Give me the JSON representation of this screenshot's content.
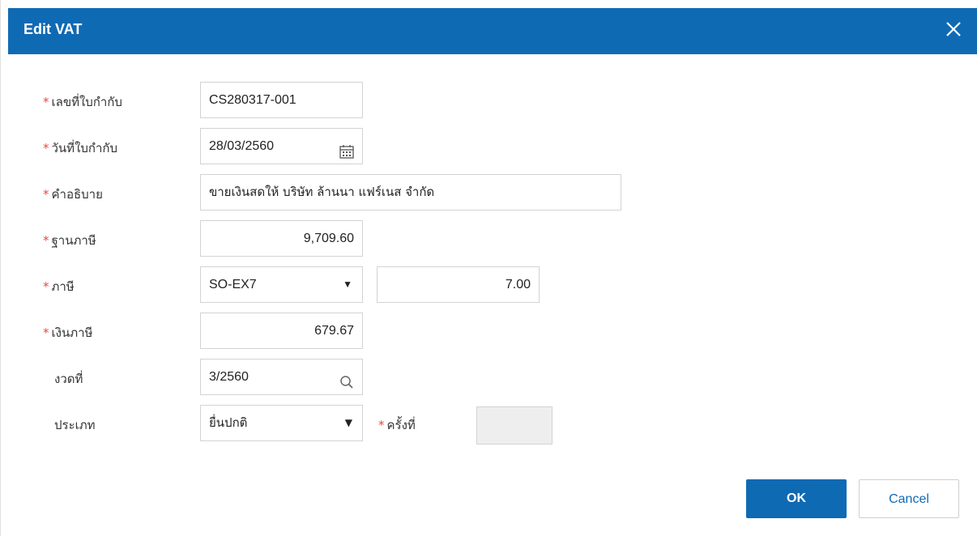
{
  "dialog": {
    "title": "Edit VAT",
    "close_icon": "close-icon"
  },
  "form": {
    "doc_no": {
      "label": "เลขที่ใบกำกับ",
      "required": true,
      "value": "CS280317-001"
    },
    "doc_date": {
      "label": "วันที่ใบกำกับ",
      "required": true,
      "value": "28/03/2560",
      "icon": "calendar-icon"
    },
    "description": {
      "label": "คำอธิบาย",
      "required": true,
      "value": "ขายเงินสดให้ บริษัท ล้านนา แฟร์เนส จำกัด"
    },
    "tax_base": {
      "label": "ฐานภาษี",
      "required": true,
      "value": "9,709.60"
    },
    "tax": {
      "label": "ภาษี",
      "required": true,
      "selected": "SO-EX7",
      "rate": "7.00"
    },
    "tax_amount": {
      "label": "เงินภาษี",
      "required": true,
      "value": "679.67"
    },
    "period": {
      "label": "งวดที่",
      "required": false,
      "value": "3/2560",
      "icon": "search-icon"
    },
    "type": {
      "label": "ประเภท",
      "required": false,
      "selected": "ยื่นปกติ"
    },
    "times": {
      "label": "ครั้งที่",
      "required": true,
      "value": ""
    }
  },
  "buttons": {
    "ok": "OK",
    "cancel": "Cancel"
  },
  "colors": {
    "header_bg": "#0f6ab4",
    "required_mark": "#e74c3c",
    "primary_button": "#0f6ab4"
  }
}
